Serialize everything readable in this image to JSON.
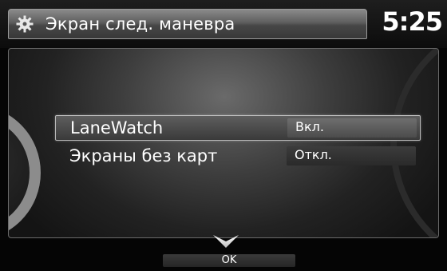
{
  "header": {
    "title": "Экран след. маневра",
    "clock": "5:25",
    "icon": "gear-icon"
  },
  "menu": {
    "items": [
      {
        "label": "LaneWatch",
        "value": "Вкл.",
        "selected": true
      },
      {
        "label": "Экраны без карт",
        "value": "Откл.",
        "selected": false
      }
    ]
  },
  "footer": {
    "ok_label": "OK",
    "scroll_icon": "chevron-down-icon"
  }
}
